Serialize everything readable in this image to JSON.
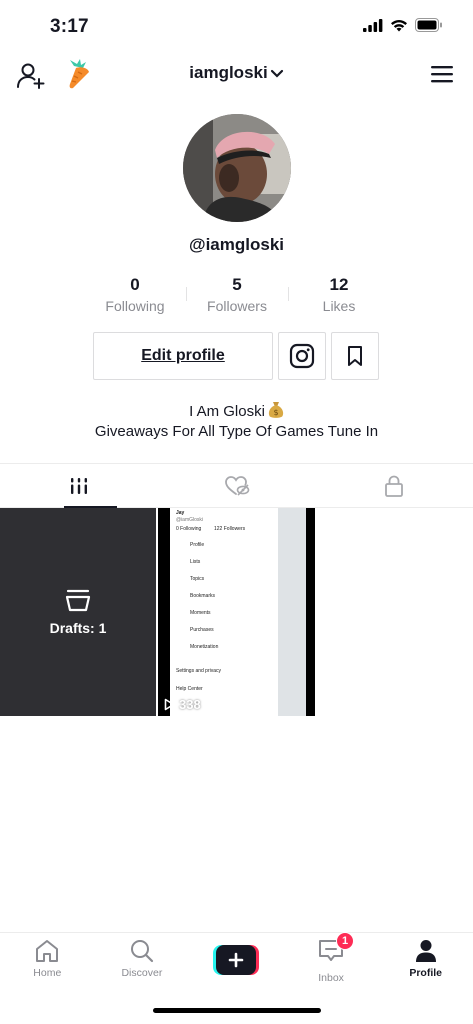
{
  "status_bar": {
    "time": "3:17"
  },
  "header": {
    "username": "iamgloski"
  },
  "profile": {
    "handle": "@iamgloski",
    "stats": [
      {
        "value": "0",
        "label": "Following"
      },
      {
        "value": "5",
        "label": "Followers"
      },
      {
        "value": "12",
        "label": "Likes"
      }
    ],
    "edit_label": "Edit profile",
    "bio_line1": "I Am Gloski",
    "bio_line2": "Giveaways For All Type Of Games Tune In"
  },
  "tabs": [
    {
      "icon": "grid-icon",
      "active": true
    },
    {
      "icon": "liked-hidden-icon",
      "active": false
    },
    {
      "icon": "lock-icon",
      "active": false
    }
  ],
  "grid": {
    "drafts_label": "Drafts: 1",
    "video": {
      "views": "338",
      "mini_name": "Jay",
      "mini_handle": "@iamGloski",
      "mini_following": "0 Following",
      "mini_followers": "122 Followers",
      "mini_menu": [
        "Profile",
        "Lists",
        "Topics",
        "Bookmarks",
        "Moments",
        "Purchases",
        "Monetization"
      ],
      "mini_settings": "Settings and privacy",
      "mini_help": "Help Center"
    }
  },
  "bottom_nav": [
    {
      "label": "Home",
      "icon": "home-icon"
    },
    {
      "label": "Discover",
      "icon": "search-icon"
    },
    {
      "label": "",
      "icon": "create-plus-icon"
    },
    {
      "label": "Inbox",
      "icon": "inbox-icon",
      "badge": "1"
    },
    {
      "label": "Profile",
      "icon": "profile-icon",
      "active": true
    }
  ],
  "colors": {
    "accent_red": "#fe2c55",
    "accent_cyan": "#25f4ee",
    "text": "#161823",
    "muted": "#8a8b91"
  }
}
